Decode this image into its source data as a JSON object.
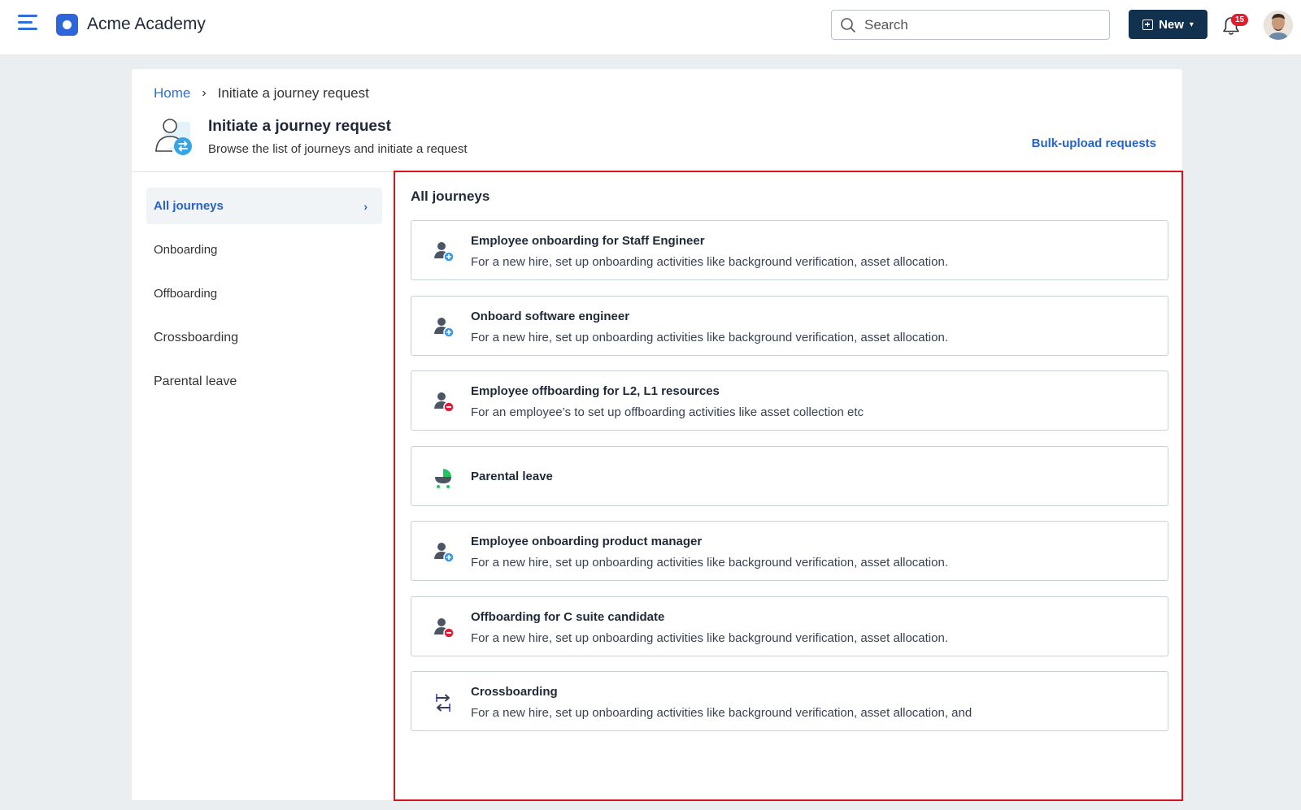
{
  "app": {
    "name": "Acme Academy"
  },
  "header": {
    "search": {
      "placeholder": "Search"
    },
    "new_label": "New",
    "notification_count": "15"
  },
  "breadcrumb": {
    "home": "Home",
    "current": "Initiate a journey request"
  },
  "page": {
    "title": "Initiate a journey request",
    "subtitle": "Browse the list of journeys and initiate a request",
    "bulk_upload_label": "Bulk-upload requests"
  },
  "sidebar": {
    "items": [
      {
        "label": "All journeys",
        "active": true
      },
      {
        "label": "Onboarding"
      },
      {
        "label": "Offboarding"
      },
      {
        "label": "Crossboarding"
      },
      {
        "label": "Parental leave"
      }
    ]
  },
  "main": {
    "section_title": "All journeys",
    "journeys": [
      {
        "title": "Employee onboarding for Staff Engineer",
        "description": "For a new hire, set up onboarding activities like background verification, asset allocation.",
        "icon": "user-add-icon"
      },
      {
        "title": "Onboard software engineer",
        "description": "For a new hire, set up onboarding activities like background verification, asset allocation.",
        "icon": "user-add-icon"
      },
      {
        "title": "Employee offboarding for L2, L1 resources",
        "description": "For an employee’s to set up offboarding activities like asset collection etc",
        "icon": "user-remove-icon"
      },
      {
        "title": "Parental leave",
        "description": "",
        "icon": "stroller-icon"
      },
      {
        "title": "Employee onboarding product manager",
        "description": "For a new hire, set up onboarding activities like background verification, asset allocation.",
        "icon": "user-add-icon"
      },
      {
        "title": "Offboarding for C suite candidate",
        "description": "For a new hire, set up onboarding activities like background verification, asset allocation.",
        "icon": "user-remove-icon"
      },
      {
        "title": "Crossboarding",
        "description": "For a new hire, set up onboarding activities like background verification, asset allocation, and",
        "icon": "swap-arrows-icon"
      }
    ]
  },
  "colors": {
    "accent": "#2f6fd6",
    "new_button": "#12314f",
    "highlight_border": "#d9121f",
    "badge": "#e11d2e"
  }
}
